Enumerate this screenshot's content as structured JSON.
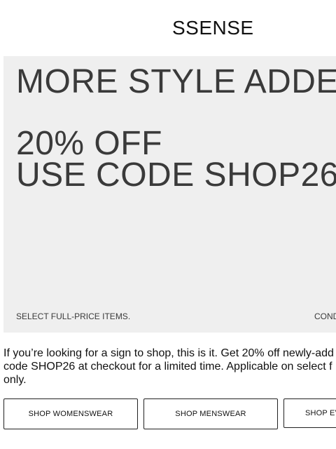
{
  "header": {
    "logo": "SSENSE"
  },
  "hero": {
    "headline": "MORE STYLE ADDED",
    "offer_line1": "20% OFF",
    "offer_line2": "USE CODE SHOP26",
    "footnote_left": "SELECT FULL-PRICE ITEMS.",
    "footnote_right": "COND"
  },
  "body": {
    "line1": "If you’re looking for a sign to shop, this is it. Get 20% off newly-add",
    "line2": "code SHOP26 at checkout for a limited time. Applicable on select f",
    "line3": "only."
  },
  "ctas": {
    "womenswear": "SHOP WOMENSWEAR",
    "menswear": "SHOP MENSWEAR",
    "everything": "SHOP EV"
  }
}
